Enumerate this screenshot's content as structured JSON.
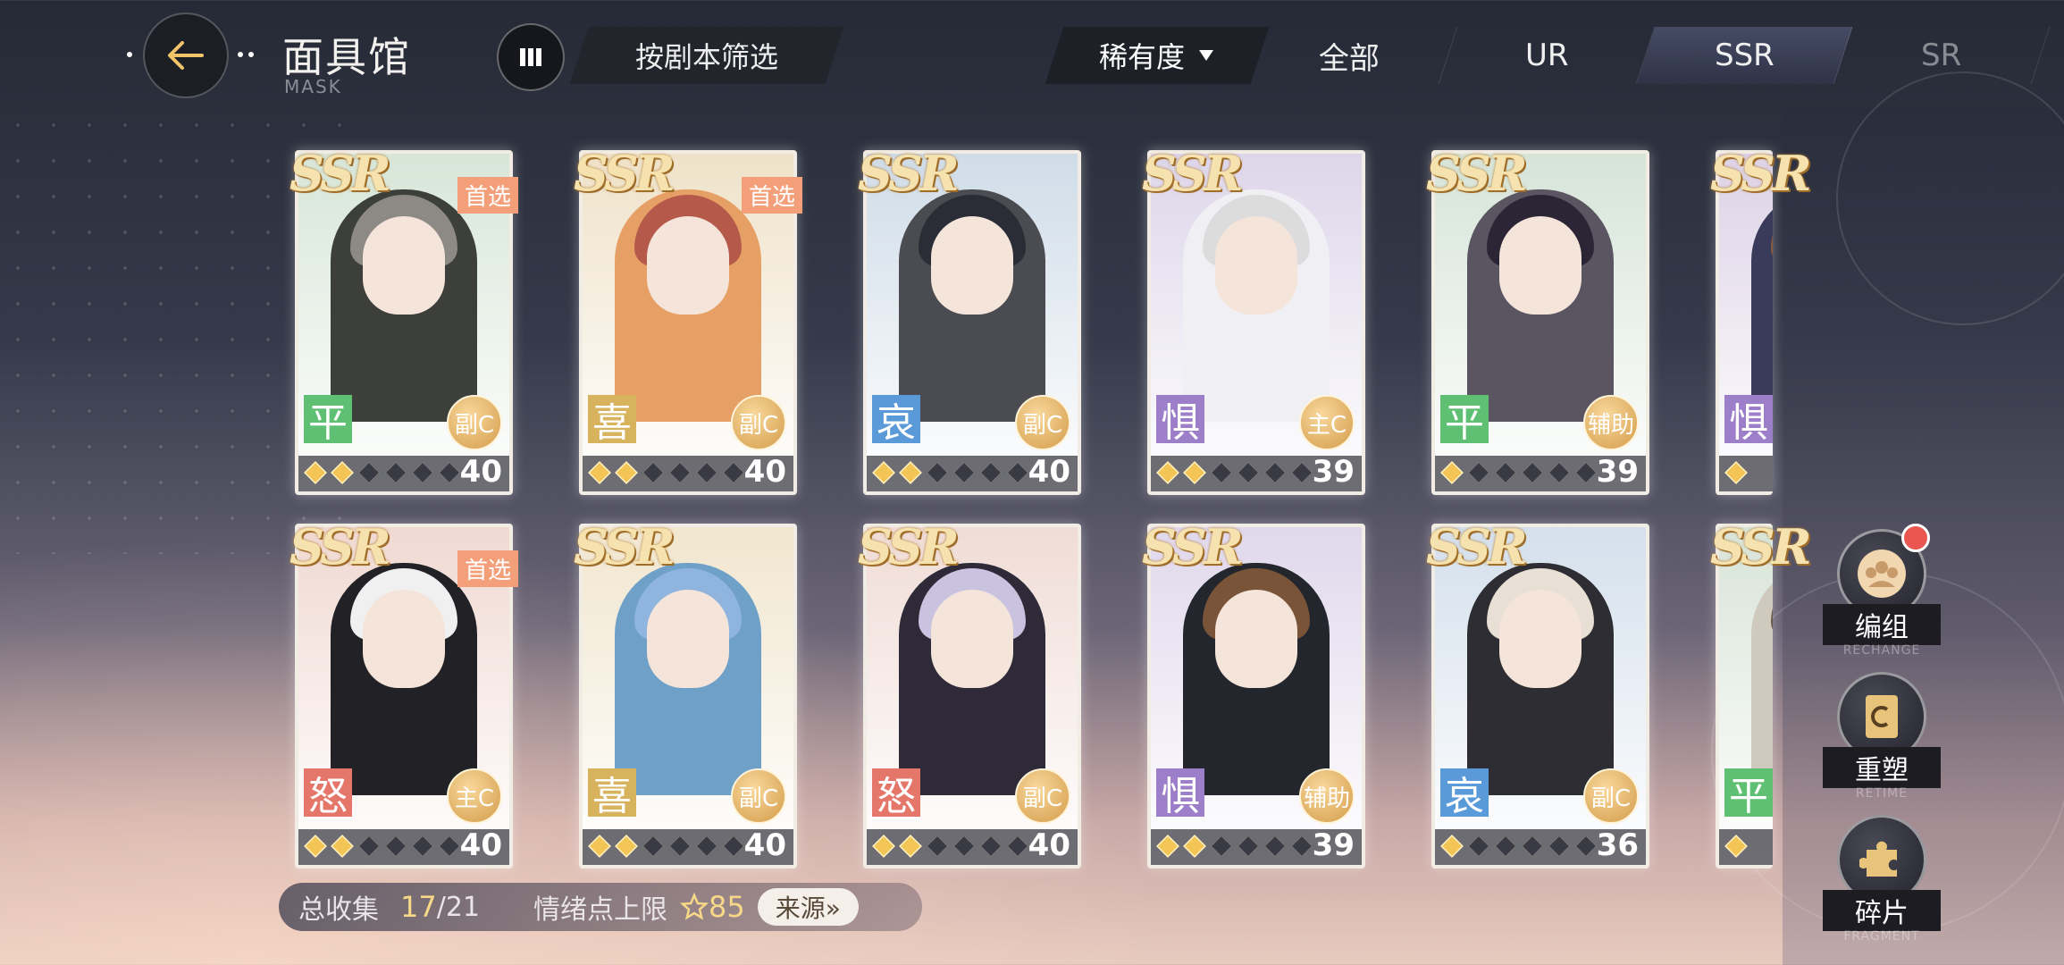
{
  "header": {
    "title": "面具馆",
    "subtitle": "MASK",
    "filter_label": "按剧本筛选",
    "rarity_label": "稀有度",
    "tabs": [
      {
        "label": "全部",
        "active": false
      },
      {
        "label": "UR",
        "active": false
      },
      {
        "label": "SSR",
        "active": true
      },
      {
        "label": "SR",
        "active": false
      }
    ]
  },
  "cards": [
    {
      "rarity": "SSR",
      "tag": "首选",
      "emotion": "平",
      "emotion_color": "#5fbf73",
      "role": "副C",
      "stars": 2,
      "level": "40",
      "bg": "#d7e6d8",
      "hair": "#8d8a86",
      "outfit": "#3c3f3a"
    },
    {
      "rarity": "SSR",
      "tag": "首选",
      "emotion": "喜",
      "emotion_color": "#d7b35e",
      "role": "副C",
      "stars": 2,
      "level": "40",
      "bg": "#efe2c9",
      "hair": "#b55a4a",
      "outfit": "#e6a065"
    },
    {
      "rarity": "SSR",
      "tag": "",
      "emotion": "哀",
      "emotion_color": "#5a9ad8",
      "role": "副C",
      "stars": 2,
      "level": "40",
      "bg": "#cfdce8",
      "hair": "#2a2d35",
      "outfit": "#4a4c52"
    },
    {
      "rarity": "SSR",
      "tag": "",
      "emotion": "惧",
      "emotion_color": "#9d7ec9",
      "role": "主C",
      "stars": 2,
      "level": "39",
      "bg": "#ddd6ea",
      "hair": "#dcdcdc",
      "outfit": "#f0f0f4"
    },
    {
      "rarity": "SSR",
      "tag": "",
      "emotion": "平",
      "emotion_color": "#5fbf73",
      "role": "辅助",
      "stars": 1,
      "level": "39",
      "bg": "#d6e4d8",
      "hair": "#2b2535",
      "outfit": "#5a5560"
    },
    {
      "rarity": "SSR",
      "tag": "",
      "emotion": "惧",
      "emotion_color": "#9d7ec9",
      "role": "",
      "stars": 1,
      "level": "",
      "bg": "#ddd2e6",
      "hair": "#8a5a3a",
      "outfit": "#3a3a5a"
    },
    {
      "rarity": "SSR",
      "tag": "首选",
      "emotion": "怒",
      "emotion_color": "#e5766a",
      "role": "主C",
      "stars": 2,
      "level": "40",
      "bg": "#f0d9d2",
      "hair": "#f0f0f0",
      "outfit": "#222226"
    },
    {
      "rarity": "SSR",
      "tag": "",
      "emotion": "喜",
      "emotion_color": "#d7b35e",
      "role": "副C",
      "stars": 2,
      "level": "40",
      "bg": "#f1e6cf",
      "hair": "#8fb5de",
      "outfit": "#6fa0c8"
    },
    {
      "rarity": "SSR",
      "tag": "",
      "emotion": "怒",
      "emotion_color": "#e5766a",
      "role": "副C",
      "stars": 2,
      "level": "40",
      "bg": "#f0dcd6",
      "hair": "#c9c3e0",
      "outfit": "#2e2a38"
    },
    {
      "rarity": "SSR",
      "tag": "",
      "emotion": "惧",
      "emotion_color": "#9d7ec9",
      "role": "辅助",
      "stars": 2,
      "level": "39",
      "bg": "#e0d8ec",
      "hair": "#7a5438",
      "outfit": "#23262c"
    },
    {
      "rarity": "SSR",
      "tag": "",
      "emotion": "哀",
      "emotion_color": "#5a9ad8",
      "role": "副C",
      "stars": 1,
      "level": "36",
      "bg": "#d4e0ec",
      "hair": "#e8e0d4",
      "outfit": "#2d2d33"
    },
    {
      "rarity": "SSR",
      "tag": "",
      "emotion": "平",
      "emotion_color": "#5fbf73",
      "role": "",
      "stars": 1,
      "level": "",
      "bg": "#d8e4d8",
      "hair": "#6a5a4a",
      "outfit": "#cfc9be"
    }
  ],
  "collection": {
    "total_label": "总收集",
    "count": "17",
    "total": "/21",
    "emotion_label": "情绪点上限",
    "emotion_value": "85",
    "source_label": "来源»"
  },
  "side": [
    {
      "label": "编组",
      "sub": "RECHANGE",
      "icon": "team-icon",
      "badge": true
    },
    {
      "label": "重塑",
      "sub": "RETIME",
      "icon": "card-reshape-icon",
      "badge": false
    },
    {
      "label": "碎片",
      "sub": "FRAGMENT",
      "icon": "puzzle-icon",
      "badge": false
    }
  ]
}
